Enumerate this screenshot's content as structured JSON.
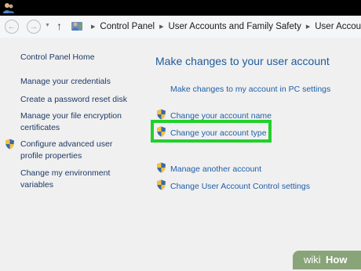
{
  "window": {
    "app_icon": "users-icon"
  },
  "nav": {
    "back_icon": "back-arrow-icon",
    "forward_icon": "forward-arrow-icon",
    "recent_icon": "dropdown-arrow-icon",
    "up_icon": "up-arrow-icon"
  },
  "breadcrumb": {
    "icon": "control-panel-icon",
    "items": [
      "Control Panel",
      "User Accounts and Family Safety",
      "User Accounts"
    ]
  },
  "sidebar": {
    "items": [
      {
        "label": "Control Panel Home"
      },
      {
        "label": "Manage your credentials"
      },
      {
        "label": "Create a password reset disk"
      },
      {
        "label": "Manage your file encryption certificates"
      },
      {
        "label": "Configure advanced user profile properties",
        "icon": "shield-icon"
      },
      {
        "label": "Change my environment variables"
      }
    ]
  },
  "main": {
    "title": "Make changes to your user account",
    "tasks": [
      {
        "label": "Make changes to my account in PC settings"
      },
      {
        "label": "Change your account name",
        "icon": "shield-icon"
      },
      {
        "label": "Change your account type",
        "icon": "shield-icon",
        "highlighted": true
      },
      {
        "label": "Manage another account",
        "icon": "shield-icon"
      },
      {
        "label": "Change User Account Control settings",
        "icon": "shield-icon"
      }
    ]
  },
  "watermark": {
    "prefix": "wiki",
    "suffix": "How"
  },
  "colors": {
    "link": "#1f5fa8",
    "title": "#1e5a9a",
    "highlight": "#22d02c",
    "background": "#f0f0f0"
  }
}
